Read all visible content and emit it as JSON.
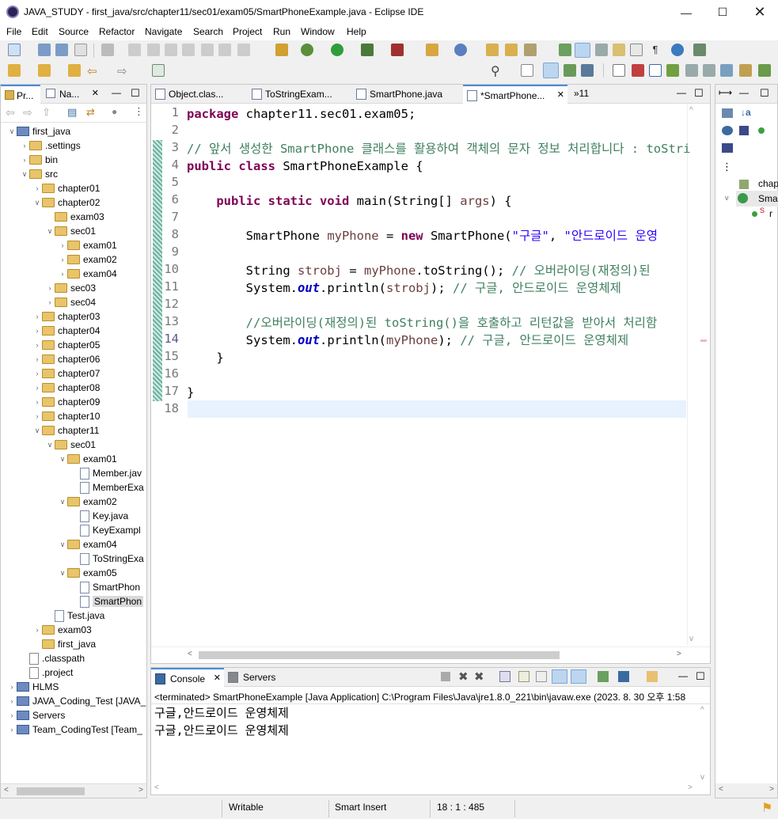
{
  "window": {
    "title": "JAVA_STUDY - first_java/src/chapter11/sec01/exam05/SmartPhoneExample.java - Eclipse IDE"
  },
  "menu": [
    "File",
    "Edit",
    "Source",
    "Refactor",
    "Navigate",
    "Search",
    "Project",
    "Run",
    "Window",
    "Help"
  ],
  "left_tabs": {
    "project_explorer": "Pr...",
    "navigator": "Na..."
  },
  "tree": [
    {
      "label": "first_java",
      "indent": 0,
      "chev": "v",
      "icon": "proj"
    },
    {
      "label": ".settings",
      "indent": 1,
      "chev": ">",
      "icon": "folder"
    },
    {
      "label": "bin",
      "indent": 1,
      "chev": ">",
      "icon": "folder"
    },
    {
      "label": "src",
      "indent": 1,
      "chev": "v",
      "icon": "folder"
    },
    {
      "label": "chapter01",
      "indent": 2,
      "chev": ">",
      "icon": "folder"
    },
    {
      "label": "chapter02",
      "indent": 2,
      "chev": "v",
      "icon": "folder"
    },
    {
      "label": "exam03",
      "indent": 3,
      "chev": "",
      "icon": "folder"
    },
    {
      "label": "sec01",
      "indent": 3,
      "chev": "v",
      "icon": "folder"
    },
    {
      "label": "exam01",
      "indent": 4,
      "chev": ">",
      "icon": "folder"
    },
    {
      "label": "exam02",
      "indent": 4,
      "chev": ">",
      "icon": "folder"
    },
    {
      "label": "exam04",
      "indent": 4,
      "chev": ">",
      "icon": "folder"
    },
    {
      "label": "sec03",
      "indent": 3,
      "chev": ">",
      "icon": "folder"
    },
    {
      "label": "sec04",
      "indent": 3,
      "chev": ">",
      "icon": "folder"
    },
    {
      "label": "chapter03",
      "indent": 2,
      "chev": ">",
      "icon": "folder"
    },
    {
      "label": "chapter04",
      "indent": 2,
      "chev": ">",
      "icon": "folder"
    },
    {
      "label": "chapter05",
      "indent": 2,
      "chev": ">",
      "icon": "folder"
    },
    {
      "label": "chapter06",
      "indent": 2,
      "chev": ">",
      "icon": "folder"
    },
    {
      "label": "chapter07",
      "indent": 2,
      "chev": ">",
      "icon": "folder"
    },
    {
      "label": "chapter08",
      "indent": 2,
      "chev": ">",
      "icon": "folder"
    },
    {
      "label": "chapter09",
      "indent": 2,
      "chev": ">",
      "icon": "folder"
    },
    {
      "label": "chapter10",
      "indent": 2,
      "chev": ">",
      "icon": "folder"
    },
    {
      "label": "chapter11",
      "indent": 2,
      "chev": "v",
      "icon": "folder"
    },
    {
      "label": "sec01",
      "indent": 3,
      "chev": "v",
      "icon": "folder"
    },
    {
      "label": "exam01",
      "indent": 4,
      "chev": "v",
      "icon": "folder"
    },
    {
      "label": "Member.jav",
      "indent": 5,
      "chev": "",
      "icon": "jfile"
    },
    {
      "label": "MemberExa",
      "indent": 5,
      "chev": "",
      "icon": "jfile"
    },
    {
      "label": "exam02",
      "indent": 4,
      "chev": "v",
      "icon": "folder"
    },
    {
      "label": "Key.java",
      "indent": 5,
      "chev": "",
      "icon": "jfile"
    },
    {
      "label": "KeyExampl",
      "indent": 5,
      "chev": "",
      "icon": "jfile"
    },
    {
      "label": "exam04",
      "indent": 4,
      "chev": "v",
      "icon": "folder"
    },
    {
      "label": "ToStringExa",
      "indent": 5,
      "chev": "",
      "icon": "jfile"
    },
    {
      "label": "exam05",
      "indent": 4,
      "chev": "v",
      "icon": "folder"
    },
    {
      "label": "SmartPhon",
      "indent": 5,
      "chev": "",
      "icon": "jfile"
    },
    {
      "label": "SmartPhon",
      "indent": 5,
      "chev": "",
      "icon": "jfile",
      "selected": true
    },
    {
      "label": "Test.java",
      "indent": 3,
      "chev": "",
      "icon": "jfile"
    },
    {
      "label": "exam03",
      "indent": 2,
      "chev": ">",
      "icon": "folder"
    },
    {
      "label": "first_java",
      "indent": 2,
      "chev": "",
      "icon": "folder"
    },
    {
      "label": ".classpath",
      "indent": 1,
      "chev": "",
      "icon": "xfile"
    },
    {
      "label": ".project",
      "indent": 1,
      "chev": "",
      "icon": "xfile"
    },
    {
      "label": "HLMS",
      "indent": 0,
      "chev": ">",
      "icon": "proj"
    },
    {
      "label": "JAVA_Coding_Test [JAVA_",
      "indent": 0,
      "chev": ">",
      "icon": "proj"
    },
    {
      "label": "Servers",
      "indent": 0,
      "chev": ">",
      "icon": "proj"
    },
    {
      "label": "Team_CodingTest [Team_",
      "indent": 0,
      "chev": ">",
      "icon": "proj"
    }
  ],
  "editor_tabs": [
    {
      "label": "Object.clas...",
      "active": false
    },
    {
      "label": "ToStringExam...",
      "active": false
    },
    {
      "label": "SmartPhone.java",
      "active": false
    },
    {
      "label": "*SmartPhone...",
      "active": true
    }
  ],
  "editor_overflow": "»11",
  "code_lines": [
    "1",
    "2",
    "3",
    "4",
    "5",
    "6",
    "7",
    "8",
    "9",
    "10",
    "11",
    "12",
    "13",
    "14",
    "15",
    "16",
    "17",
    "18"
  ],
  "code": {
    "l1_kw": "package",
    "l1_rest": " chapter11.sec01.exam05;",
    "l3": "// 앞서 생성한 SmartPhone 클래스를 활용하여 객체의 문자 정보 처리합니다 : toStri",
    "l4_kw1": "public",
    "l4_kw2": " class",
    "l4_rest": " SmartPhoneExample {",
    "l6_kw": "    public static void",
    "l6_rest": " main(String[] ",
    "l6_var": "args",
    "l6_end": ") {",
    "l8_a": "        SmartPhone ",
    "l8_var": "myPhone",
    "l8_b": " = ",
    "l8_kw": "new",
    "l8_c": " SmartPhone(",
    "l8_s1": "\"구글\"",
    "l8_d": ", ",
    "l8_s2": "\"안드로이드 운영",
    "l10_a": "        String ",
    "l10_var": "strobj",
    "l10_b": " = ",
    "l10_var2": "myPhone",
    "l10_c": ".toString(); ",
    "l10_cm": "// 오버라이딩(재정의)된",
    "l11_a": "        System.",
    "l11_fld": "out",
    "l11_b": ".println(",
    "l11_var": "strobj",
    "l11_c": "); ",
    "l11_cm": "// 구글, 안드로이드 운영체제",
    "l13_cm": "        //오버라이딩(재정의)된 toString()을 호출하고 리턴값을 받아서 처리함",
    "l14_a": "        System.",
    "l14_fld": "out",
    "l14_b": ".println(",
    "l14_var": "myPhone",
    "l14_c": "); ",
    "l14_cm": "// 구글, 안드로이드 운영체제",
    "l15": "    }",
    "l17": "}"
  },
  "console": {
    "tab_console": "Console",
    "tab_servers": "Servers",
    "header": "<terminated> SmartPhoneExample [Java Application] C:\\Program Files\\Java\\jre1.8.0_221\\bin\\javaw.exe  (2023. 8. 30 오후 1:58",
    "out1": "구글,안드로이드 운영체제",
    "out2": "구글,안드로이드 운영체제"
  },
  "outline": {
    "item1": "chap",
    "item2": "Sma"
  },
  "statusbar": {
    "mode": "Writable",
    "insert": "Smart Insert",
    "position": "18 : 1 : 485"
  }
}
